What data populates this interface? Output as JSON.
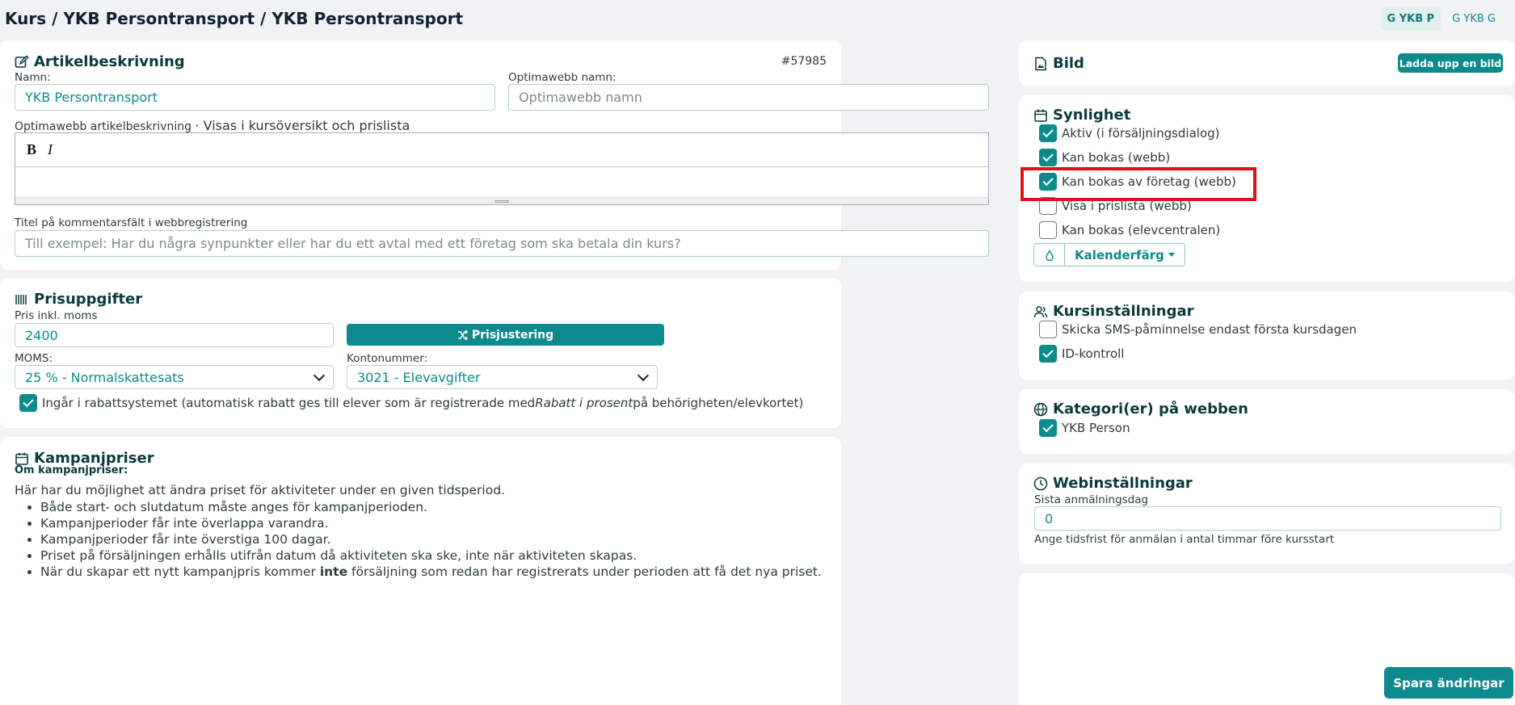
{
  "header": {
    "title": "Kurs / YKB Persontransport / YKB Persontransport",
    "tabs": [
      "G YKB P",
      "G YKB G"
    ]
  },
  "article": {
    "title": "Artikelbeskrivning",
    "id": "#57985",
    "name_label": "Namn:",
    "name_value": "YKB Persontransport",
    "optima_name_label": "Optimawebb namn:",
    "optima_name_placeholder": "Optimawebb namn",
    "desc_label": "Optimawebb artikelbeskrivning",
    "desc_hint": "· Visas i kursöversikt och prislista",
    "bold": "B",
    "italic": "I",
    "comment_label": "Titel på kommentarsfält i webbregistrering",
    "comment_placeholder": "Till exempel: Har du några synpunkter eller har du ett avtal med ett företag som ska betala din kurs?"
  },
  "price": {
    "title": "Prisuppgifter",
    "price_label": "Pris inkl. moms",
    "price_value": "2400",
    "adjust_button": "Prisjustering",
    "vat_label": "MOMS:",
    "vat_value": "25 % - Normalskattesats",
    "account_label": "Kontonummer:",
    "account_value": "3021 - Elevavgifter",
    "discount_text_1": "Ingår i rabattsystemet (automatisk rabatt ges till elever som är registrerade med",
    "discount_text_italic": "Rabatt i prosent",
    "discount_text_2": "på behörigheten/elevkortet)"
  },
  "campaign": {
    "title": "Kampanjpriser",
    "subtitle": "Om kampanjpriser:",
    "intro": "Här har du möjlighet att ändra priset för aktiviteter under en given tidsperiod.",
    "bullets": [
      "Både start- och slutdatum måste anges för kampanjperioden.",
      "Kampanjperioder får inte överlappa varandra.",
      "Kampanjperioder får inte överstiga 100 dagar.",
      "Priset på försäljningen erhålls utifrån datum då aktiviteten ska ske, inte när aktiviteten skapas."
    ],
    "last_bullet_1": "När du skapar ett nytt kampanjpris kommer ",
    "last_bullet_bold": "inte",
    "last_bullet_2": " försäljning som redan har registrerats under perioden att få det nya priset."
  },
  "image": {
    "title": "Bild",
    "upload_button": "Ladda upp en bild"
  },
  "visibility": {
    "title": "Synlighet",
    "items": [
      {
        "label": "Aktiv (i försäljningsdialog)",
        "checked": true
      },
      {
        "label": "Kan bokas (webb)",
        "checked": true
      },
      {
        "label": "Kan bokas av företag (webb)",
        "checked": true
      },
      {
        "label": "Visa i prislista (webb)",
        "checked": false
      },
      {
        "label": "Kan bokas (elevcentralen)",
        "checked": false
      }
    ],
    "calendar_color": "Kalenderfärg"
  },
  "course_settings": {
    "title": "Kursinställningar",
    "items": [
      {
        "label": "Skicka SMS-påminnelse endast första kursdagen",
        "checked": false
      },
      {
        "label": "ID-kontroll",
        "checked": true
      }
    ]
  },
  "categories": {
    "title": "Kategori(er) på webben",
    "items": [
      {
        "label": "YKB Person",
        "checked": true
      }
    ]
  },
  "web_settings": {
    "title": "Webinställningar",
    "deadline_label": "Sista anmälningsdag",
    "deadline_value": "0",
    "deadline_hint": "Ange tidsfrist för anmälan i antal timmar före kursstart"
  },
  "save_button": "Spara ändringar",
  "colors": {
    "accent": "#0d8a8c",
    "highlight": "#e0101c"
  }
}
